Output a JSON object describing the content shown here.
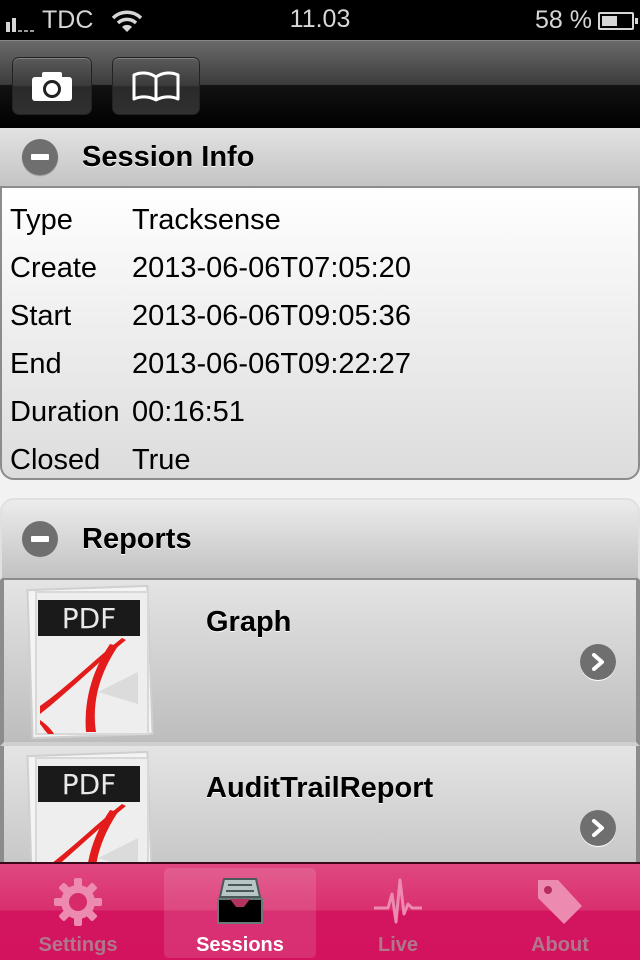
{
  "status_bar": {
    "carrier": "TDC",
    "time": "11.03",
    "battery_text": "58 %",
    "battery_level": 0.58,
    "signal_bars": 2,
    "wifi": true
  },
  "toolbar": {
    "buttons": [
      {
        "icon": "camera-icon",
        "label": "Camera"
      },
      {
        "icon": "book-icon",
        "label": "Book"
      }
    ]
  },
  "session_info": {
    "title": "Session Info",
    "rows": [
      {
        "key": "Type",
        "value": "Tracksense"
      },
      {
        "key": "Create",
        "value": "2013-06-06T07:05:20"
      },
      {
        "key": "Start",
        "value": "2013-06-06T09:05:36"
      },
      {
        "key": "End",
        "value": "2013-06-06T09:22:27"
      },
      {
        "key": "Duration",
        "value": "00:16:51"
      },
      {
        "key": "Closed",
        "value": "True"
      }
    ]
  },
  "reports": {
    "title": "Reports",
    "items": [
      {
        "name": "Graph",
        "icon_text": "PDF"
      },
      {
        "name": "AuditTrailReport",
        "icon_text": "PDF"
      }
    ]
  },
  "tab_bar": {
    "active": "Sessions",
    "tabs": [
      {
        "label": "Settings",
        "icon": "gear-icon"
      },
      {
        "label": "Sessions",
        "icon": "inbox-tray-icon"
      },
      {
        "label": "Live",
        "icon": "heartbeat-icon"
      },
      {
        "label": "About",
        "icon": "tag-icon"
      }
    ]
  },
  "colors": {
    "tab_bar": "#d3135e",
    "tab_label_inactive": "#b0778d",
    "tab_label_active": "#ffffff",
    "pdf_red": "#e31b1b"
  }
}
